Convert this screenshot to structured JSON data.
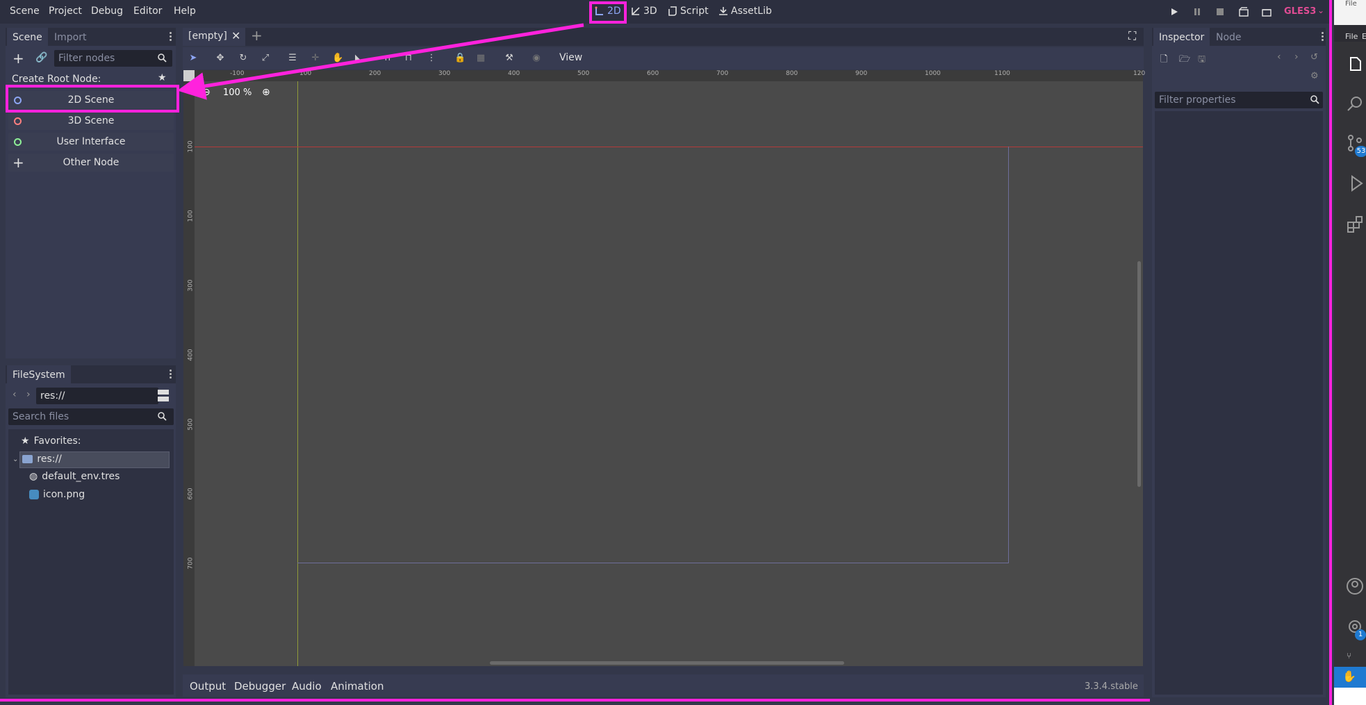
{
  "menu": [
    "Scene",
    "Project",
    "Debug",
    "Editor",
    "Help"
  ],
  "workspaces": [
    "2D",
    "3D",
    "Script",
    "AssetLib"
  ],
  "renderer": "GLES3",
  "scene_dock": {
    "tabs": [
      "Scene",
      "Import"
    ],
    "filter_placeholder": "Filter nodes",
    "create_root_label": "Create Root Node:",
    "nodes": [
      "2D Scene",
      "3D Scene",
      "User Interface",
      "Other Node"
    ]
  },
  "filesystem": {
    "tab": "FileSystem",
    "path": "res://",
    "search_placeholder": "Search files",
    "favorites": "Favorites:",
    "root": "res://",
    "files": [
      "default_env.tres",
      "icon.png"
    ]
  },
  "editor": {
    "scene_tab": "[empty]",
    "view_menu": "View",
    "zoom": "100 %",
    "ruler_top": [
      "-100",
      "0",
      "100",
      "200",
      "300",
      "400",
      "500",
      "600",
      "700",
      "800",
      "900",
      "1000",
      "1100",
      "120"
    ],
    "ruler_left": [
      "0",
      "100",
      "200",
      "300",
      "400",
      "500",
      "600",
      "700"
    ]
  },
  "bottom_panel": {
    "tabs": [
      "Output",
      "Debugger",
      "Audio",
      "Animation"
    ],
    "version": "3.3.4.stable"
  },
  "inspector": {
    "tabs": [
      "Inspector",
      "Node"
    ],
    "filter_placeholder": "Filter properties"
  },
  "vscode_strip": {
    "menu": [
      "File",
      "E"
    ],
    "scm_badge": "53",
    "settings_badge": "1"
  },
  "colors": {
    "highlight": "#ff22dd",
    "viewport": "#4a4a4a",
    "ring_2d": "#8da5f3",
    "ring_3d": "#fc7f7f",
    "ring_ui": "#8eef97",
    "gles": "#e04c94"
  }
}
